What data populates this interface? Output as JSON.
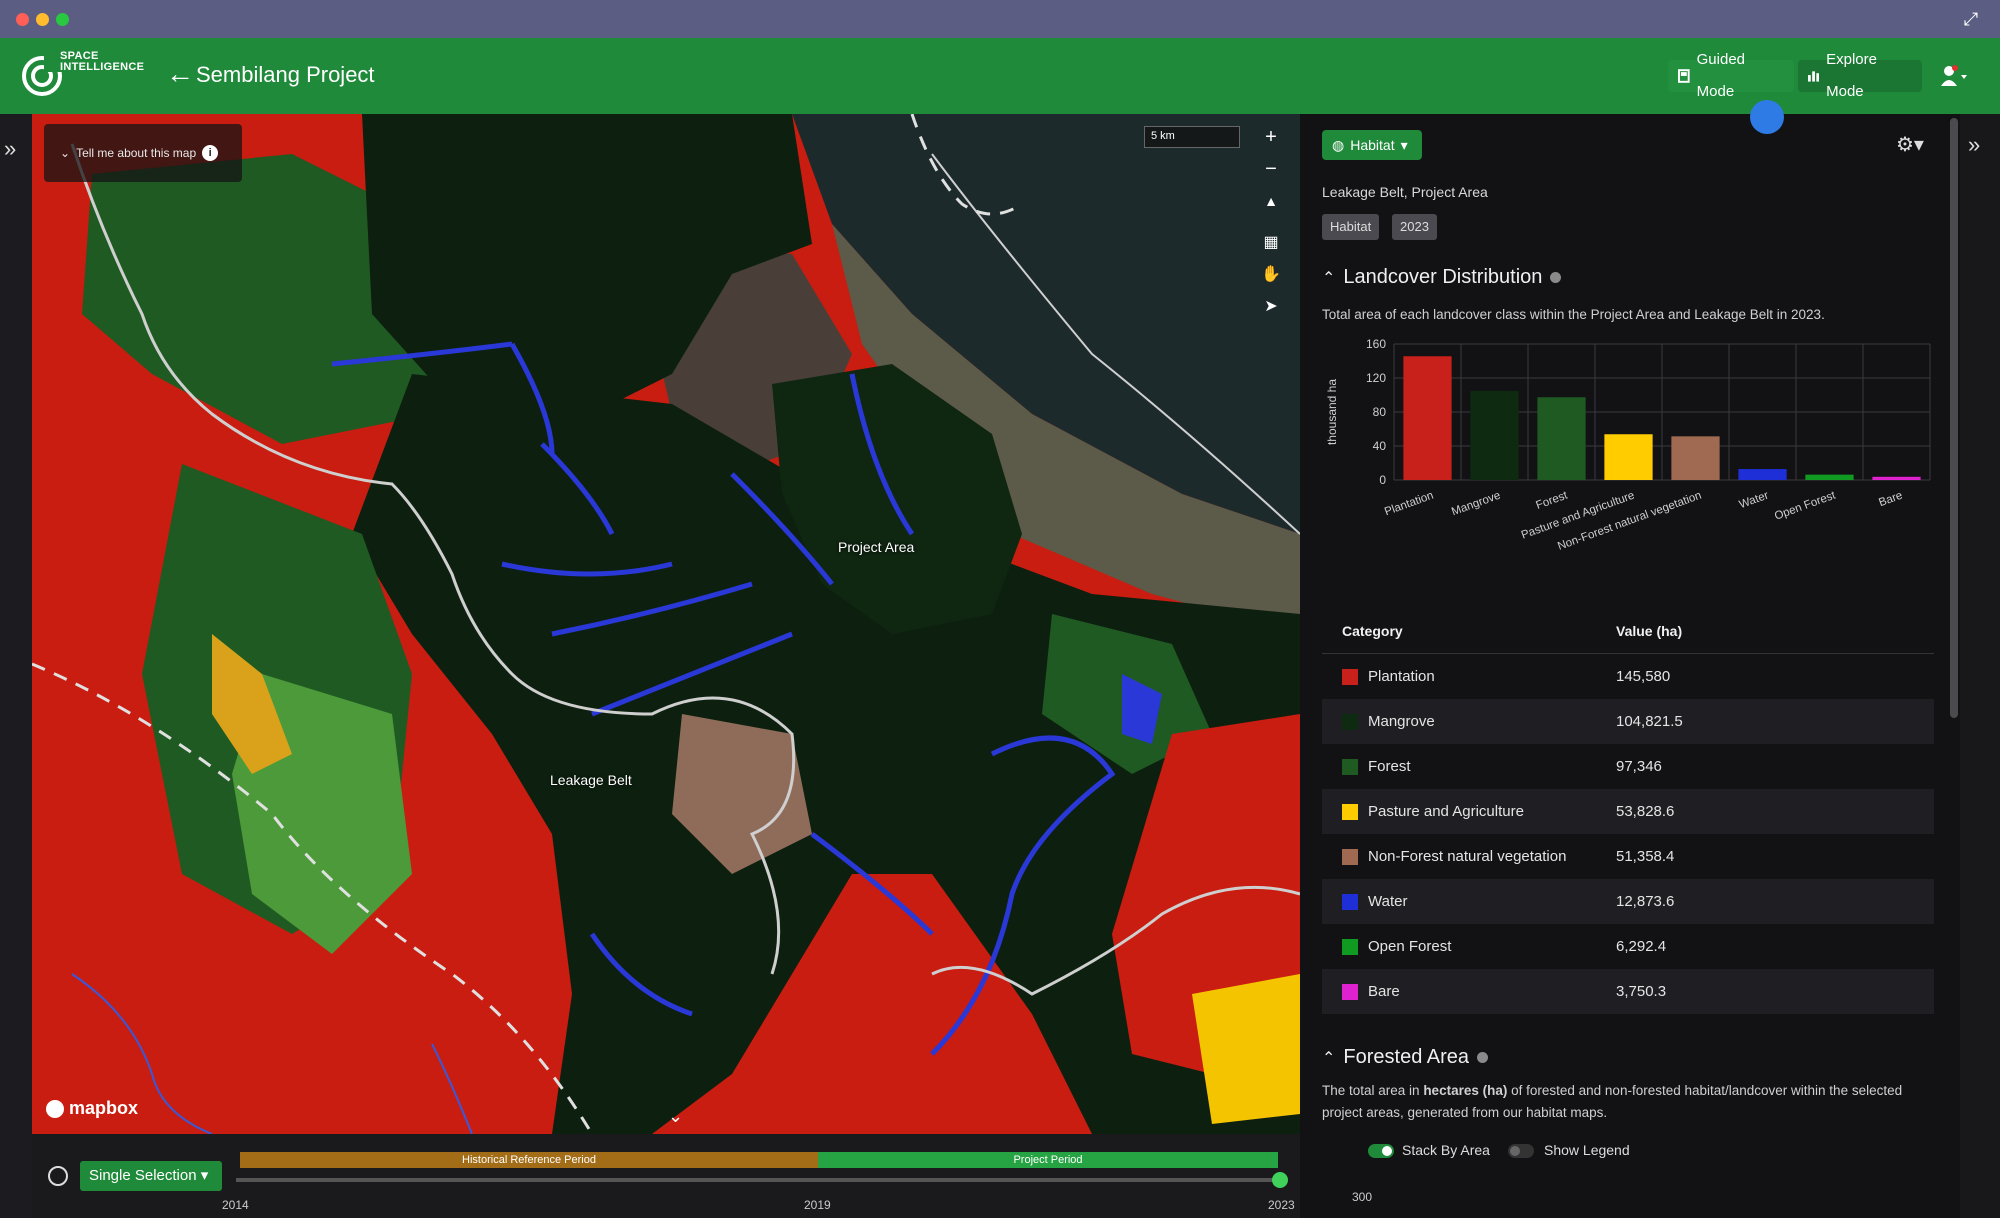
{
  "window": {
    "traffic_lights": [
      "#ff5f57",
      "#febc2e",
      "#28c840"
    ]
  },
  "brand": {
    "line1": "SPACE",
    "line2": "INTELLIGENCE"
  },
  "header": {
    "project_title": "Sembilang Project",
    "guided_mode": "Guided Mode",
    "explore_mode": "Explore Mode"
  },
  "map": {
    "info_button": "Tell me about this map",
    "scale": "5 km",
    "label_project_area": "Project Area",
    "label_leakage_belt": "Leakage Belt",
    "attribution": "mapbox"
  },
  "timeline": {
    "mode": "Single Selection",
    "historical": "Historical Reference Period",
    "project": "Project Period",
    "year_start": "2014",
    "year_mid": "2019",
    "year_end": "2023"
  },
  "panel": {
    "layer_dropdown": "Habitat",
    "subtitle": "Leakage Belt, Project Area",
    "tags": [
      "Habitat",
      "2023"
    ],
    "landcover": {
      "title": "Landcover Distribution",
      "description": "Total area of each landcover class within the Project Area and Leakage Belt in 2023."
    },
    "table": {
      "col_category": "Category",
      "col_value": "Value (ha)",
      "rows": [
        {
          "name": "Plantation",
          "value": "145,580",
          "color": "#c8201a"
        },
        {
          "name": "Mangrove",
          "value": "104,821.5",
          "color": "#0e2a10"
        },
        {
          "name": "Forest",
          "value": "97,346",
          "color": "#1e5a22"
        },
        {
          "name": "Pasture and Agriculture",
          "value": "53,828.6",
          "color": "#ffcc00"
        },
        {
          "name": "Non-Forest natural vegetation",
          "value": "51,358.4",
          "color": "#a06a52"
        },
        {
          "name": "Water",
          "value": "12,873.6",
          "color": "#1e2fd8"
        },
        {
          "name": "Open Forest",
          "value": "6,292.4",
          "color": "#119a22"
        },
        {
          "name": "Bare",
          "value": "3,750.3",
          "color": "#e021d0"
        }
      ]
    },
    "forested": {
      "title": "Forested Area",
      "desc_pre": "The total area in ",
      "desc_bold": "hectares (ha)",
      "desc_post": " of forested and non-forested habitat/landcover within the selected project areas, generated from our habitat maps.",
      "toggle_stack": "Stack By Area",
      "toggle_legend": "Show Legend",
      "axis_top": "300"
    }
  },
  "chart_data": {
    "type": "bar",
    "categories": [
      "Plantation",
      "Mangrove",
      "Forest",
      "Pasture and Agriculture",
      "Non-Forest natural vegetation",
      "Water",
      "Open Forest",
      "Bare"
    ],
    "values": [
      145.58,
      104.82,
      97.35,
      53.83,
      51.36,
      12.87,
      6.29,
      3.75
    ],
    "colors": [
      "#c8201a",
      "#0e2a10",
      "#1e5a22",
      "#ffcc00",
      "#a06a52",
      "#1e2fd8",
      "#119a22",
      "#e021d0"
    ],
    "ylabel": "thousand ha",
    "ylim": [
      0,
      160
    ],
    "yticks": [
      0,
      40,
      80,
      120,
      160
    ],
    "grid": true
  }
}
